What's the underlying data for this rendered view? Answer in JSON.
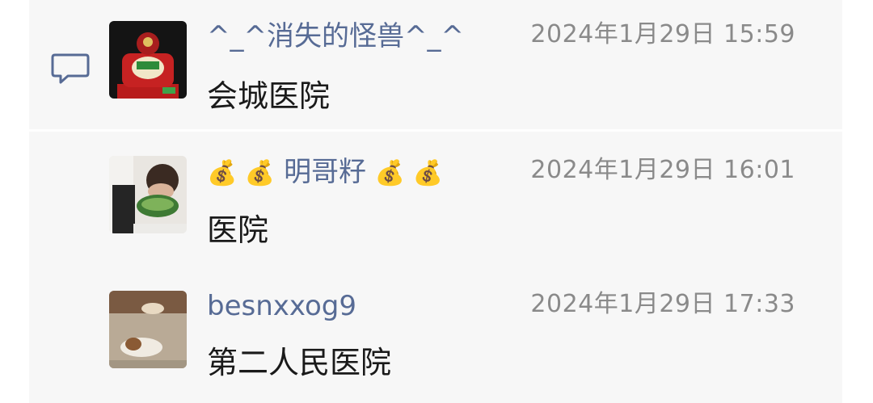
{
  "comments": [
    {
      "name": "^_^消失的怪兽^_^",
      "time": "2024年1月29日 15:59",
      "message": "会城医院"
    },
    {
      "name_prefix": "💰 💰",
      "name": "明哥籽",
      "name_suffix": "💰 💰",
      "time": "2024年1月29日 16:01",
      "message": "医院"
    },
    {
      "name": "besnxxog9",
      "time": "2024年1月29日 17:33",
      "message": "第二人民医院"
    }
  ],
  "colors": {
    "name": "#576b95",
    "time": "#8a8a8a",
    "message": "#1a1a1a",
    "panel": "#f7f7f7"
  },
  "icons": {
    "section": "comment-bubble-icon",
    "avatars": [
      "avatar-figure-on-red-chair",
      "avatar-person-eating-watermelon",
      "avatar-dogs-on-floor"
    ]
  }
}
